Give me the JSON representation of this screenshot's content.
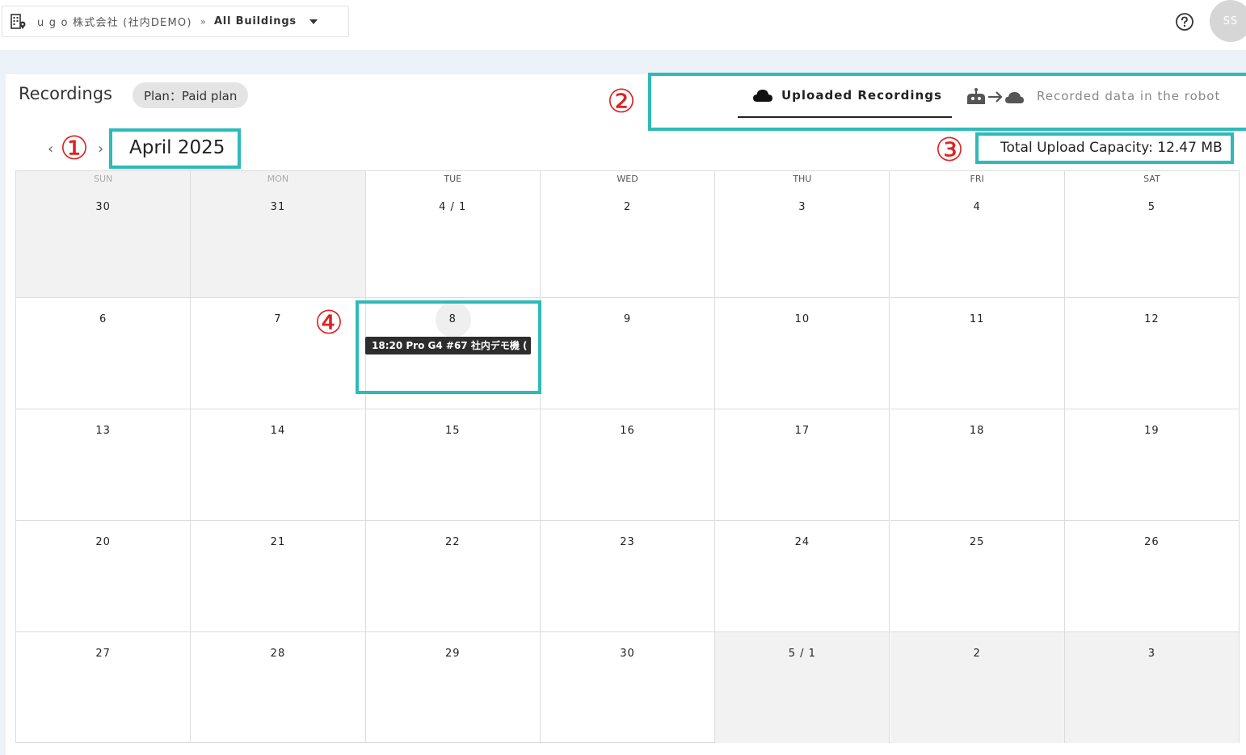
{
  "header": {
    "org_name": "u g o 株式会社 (社内DEMO)",
    "separator": "»",
    "building": "All Buildings",
    "user_initials": "SS"
  },
  "page": {
    "title": "Recordings",
    "plan": "Plan：Paid plan"
  },
  "tabs": [
    {
      "label": "Uploaded Recordings",
      "active": true,
      "icon": "cloud-icon"
    },
    {
      "label": "Recorded data in the robot",
      "active": false,
      "icon": "robot-to-cloud-icon"
    }
  ],
  "month_nav": {
    "prev": "‹",
    "next": "›",
    "month": "April 2025"
  },
  "capacity": "Total Upload Capacity: 12.47 MB",
  "annotations": [
    "①",
    "②",
    "③",
    "④"
  ],
  "calendar": {
    "weekdays": [
      "SUN",
      "MON",
      "TUE",
      "WED",
      "THU",
      "FRI",
      "SAT"
    ],
    "weeks": [
      [
        {
          "d": "30",
          "other": true
        },
        {
          "d": "31",
          "other": true
        },
        {
          "d": "4 / 1"
        },
        {
          "d": "2"
        },
        {
          "d": "3"
        },
        {
          "d": "4"
        },
        {
          "d": "5"
        }
      ],
      [
        {
          "d": "6"
        },
        {
          "d": "7"
        },
        {
          "d": "8",
          "today": true
        },
        {
          "d": "9"
        },
        {
          "d": "10"
        },
        {
          "d": "11"
        },
        {
          "d": "12"
        }
      ],
      [
        {
          "d": "13"
        },
        {
          "d": "14"
        },
        {
          "d": "15"
        },
        {
          "d": "16"
        },
        {
          "d": "17"
        },
        {
          "d": "18"
        },
        {
          "d": "19"
        }
      ],
      [
        {
          "d": "20"
        },
        {
          "d": "21"
        },
        {
          "d": "22"
        },
        {
          "d": "23"
        },
        {
          "d": "24"
        },
        {
          "d": "25"
        },
        {
          "d": "26"
        }
      ],
      [
        {
          "d": "27"
        },
        {
          "d": "28"
        },
        {
          "d": "29"
        },
        {
          "d": "30"
        },
        {
          "d": "5 / 1",
          "other": true
        },
        {
          "d": "2",
          "other": true
        },
        {
          "d": "3",
          "other": true
        }
      ]
    ],
    "events": [
      {
        "date": "8",
        "label": "18:20 Pro G4 #67 社内デモ機 ("
      }
    ]
  },
  "colors": {
    "highlight": "#2dbab9",
    "annotation": "#e02020",
    "event_bg": "#2d2d2d",
    "other_month_bg": "#f2f2f2"
  }
}
